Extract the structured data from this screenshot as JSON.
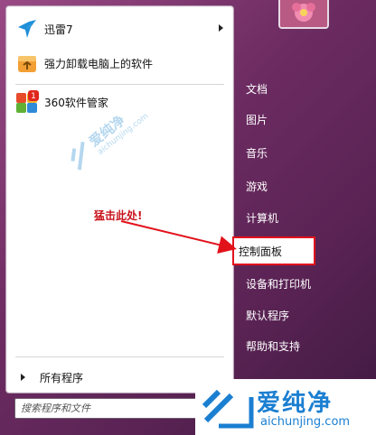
{
  "pinned": [
    {
      "label": "迅雷7",
      "icon": "thunder-bird-icon",
      "has_submenu": true
    },
    {
      "label": "强力卸载电脑上的软件",
      "icon": "uninstall-box-icon",
      "has_submenu": false
    },
    {
      "label": "360软件管家",
      "icon": "360-software-manager-icon",
      "has_submenu": false,
      "badge": "1"
    }
  ],
  "all_programs": "所有程序",
  "search": {
    "placeholder": "搜索程序和文件"
  },
  "right_menu": [
    {
      "label": "文档"
    },
    {
      "label": "图片"
    },
    {
      "label": "音乐"
    },
    {
      "label": "游戏"
    },
    {
      "label": "计算机"
    },
    {
      "label": "控制面板"
    },
    {
      "label": "设备和打印机"
    },
    {
      "label": "默认程序"
    },
    {
      "label": "帮助和支持"
    }
  ],
  "annotation": "猛击此处!",
  "watermark": {
    "cn": "爱纯净",
    "en": "aichunjing.com"
  },
  "colors": {
    "highlight_border": "#e2121b",
    "annotation": "#c8121b",
    "watermark": "#1b7fd1",
    "menu_bg": "#6d2c62"
  }
}
